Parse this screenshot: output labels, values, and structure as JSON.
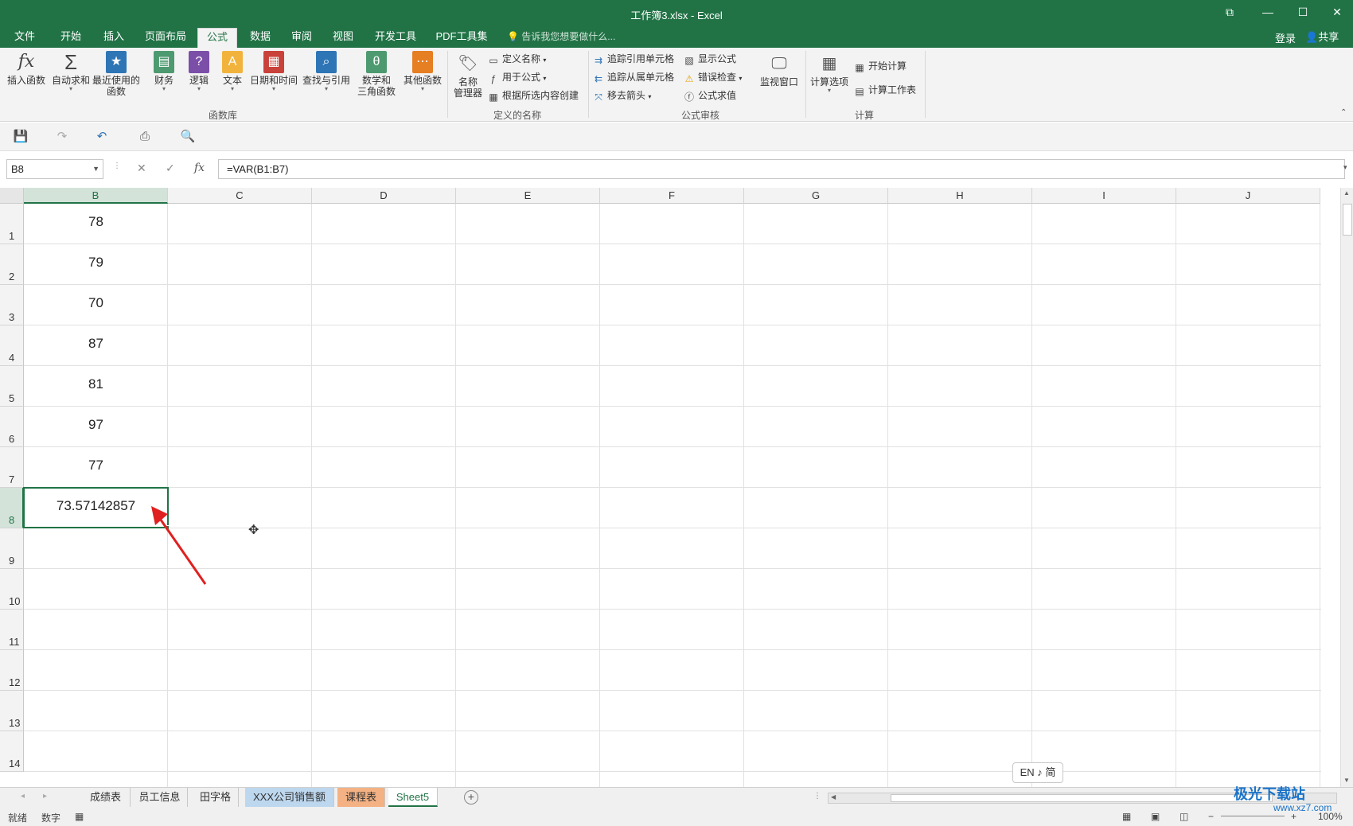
{
  "window": {
    "title": "工作簿3.xlsx - Excel",
    "buttons": [
      "⧉",
      "—",
      "☐",
      "✕"
    ]
  },
  "ribbon_tabs": [
    {
      "label": "文件",
      "active": false
    },
    {
      "label": "开始",
      "active": false
    },
    {
      "label": "插入",
      "active": false
    },
    {
      "label": "页面布局",
      "active": false
    },
    {
      "label": "公式",
      "active": true
    },
    {
      "label": "数据",
      "active": false
    },
    {
      "label": "审阅",
      "active": false
    },
    {
      "label": "视图",
      "active": false
    },
    {
      "label": "开发工具",
      "active": false
    },
    {
      "label": "PDF工具集",
      "active": false
    }
  ],
  "tell_me": "告诉我您想要做什么...",
  "login": "登录",
  "share": "共享",
  "ribbon": {
    "function_library": {
      "group_label": "函数库",
      "buttons": [
        {
          "label": "插入函数",
          "label2": "",
          "icon": "fx-icon",
          "color": "#5a5a5a"
        },
        {
          "label": "自动求和",
          "label2": "",
          "icon": "sigma-icon",
          "color": "#5a5a5a"
        },
        {
          "label": "最近使用的",
          "label2": "函数",
          "icon": "star-book-icon",
          "color": "#2e75b6"
        },
        {
          "label": "财务",
          "label2": "",
          "icon": "finance-book-icon",
          "color": "#4e9a70"
        },
        {
          "label": "逻辑",
          "label2": "",
          "icon": "logic-book-icon",
          "color": "#7b4fa8"
        },
        {
          "label": "文本",
          "label2": "",
          "icon": "text-book-icon",
          "color": "#f2b33d"
        },
        {
          "label": "日期和时间",
          "label2": "",
          "icon": "calendar-book-icon",
          "color": "#c9423a"
        },
        {
          "label": "查找与引用",
          "label2": "",
          "icon": "lookup-book-icon",
          "color": "#2e75b6"
        },
        {
          "label": "数学和",
          "label2": "三角函数",
          "icon": "theta-book-icon",
          "color": "#4e9a70"
        },
        {
          "label": "其他函数",
          "label2": "",
          "icon": "more-book-icon",
          "color": "#e67e22"
        }
      ]
    },
    "defined_names": {
      "group_label": "定义的名称",
      "name_manager": "名称",
      "name_manager2": "管理器",
      "items": [
        "定义名称",
        "用于公式",
        "根据所选内容创建"
      ]
    },
    "formula_auditing": {
      "group_label": "公式审核",
      "items_left": [
        "追踪引用单元格",
        "追踪从属单元格",
        "移去箭头"
      ],
      "items_right": [
        "显示公式",
        "错误检查",
        "公式求值"
      ],
      "watch_window": "监视窗口"
    },
    "calculation": {
      "group_label": "计算",
      "calc_options": "计算选项",
      "items": [
        "开始计算",
        "计算工作表"
      ]
    }
  },
  "formula_bar": {
    "name_box": "B8",
    "formula": "=VAR(B1:B7)",
    "cancel": "✕",
    "enter": "✓",
    "fx": "fx"
  },
  "grid": {
    "columns": [
      "B",
      "C",
      "D",
      "E",
      "F",
      "G",
      "H",
      "I",
      "J"
    ],
    "selected_column": "B",
    "rows": [
      "1",
      "2",
      "3",
      "4",
      "5",
      "6",
      "7",
      "8",
      "9",
      "10",
      "11",
      "12",
      "13",
      "14"
    ],
    "selected_row": "8",
    "column_b_values": [
      "78",
      "79",
      "70",
      "87",
      "81",
      "97",
      "77",
      "73.57142857"
    ]
  },
  "ime_indicator": "EN ♪ 简",
  "sheet_tabs": [
    {
      "label": "成绩表",
      "style": "normal"
    },
    {
      "label": "员工信息",
      "style": "normal"
    },
    {
      "label": "田字格",
      "style": "normal"
    },
    {
      "label": "XXX公司销售额",
      "style": "blue"
    },
    {
      "label": "课程表",
      "style": "orange"
    },
    {
      "label": "Sheet5",
      "style": "active"
    }
  ],
  "status_bar": {
    "ready": "就绪",
    "mode": "数字",
    "zoom": "100%"
  },
  "watermark": {
    "text": "极光下载站",
    "sub": "www.xz7.com"
  },
  "colors": {
    "brand": "#217346",
    "annotation_arrow": "#e02020"
  }
}
